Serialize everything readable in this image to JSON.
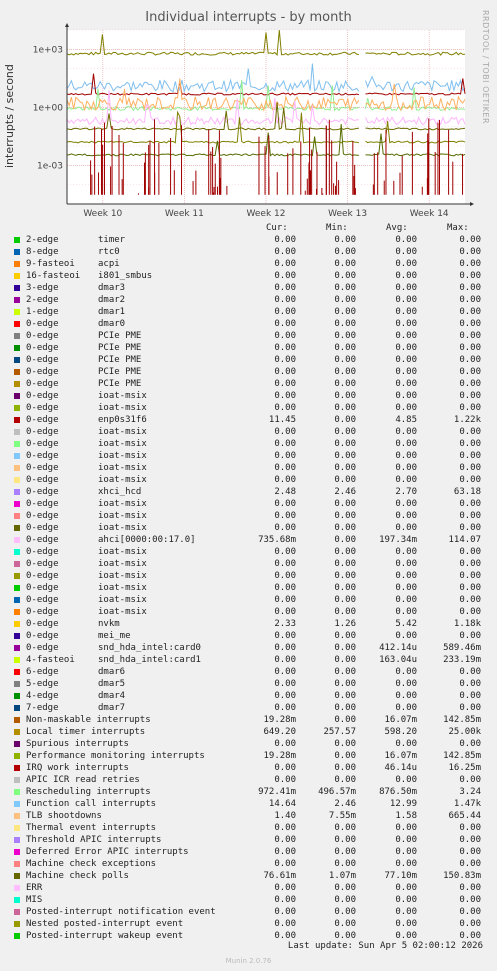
{
  "title": "Individual interrupts - by month",
  "vendor": "RRDTOOL / TOBI OETIKER",
  "ylabel": "interrupts / second",
  "chart_data": {
    "type": "line",
    "yscale": "log",
    "title": "Individual interrupts - by month",
    "ylabel": "interrupts / second",
    "ylim": [
      1e-05,
      10000
    ],
    "yticks": [
      {
        "v": 1000,
        "label": "1e+03"
      },
      {
        "v": 1,
        "label": "1e+00"
      },
      {
        "v": 0.001,
        "label": "1e-03"
      }
    ],
    "x_ticks": [
      "Week 10",
      "Week 11",
      "Week 12",
      "Week 13",
      "Week 14"
    ],
    "x_gap": [
      0.735,
      0.745
    ],
    "bands": [
      {
        "name": "Local timer interrupts",
        "color": "#808000",
        "base": 598,
        "noise": 0.15
      },
      {
        "name": "Function call interrupts",
        "color": "#7fbfef",
        "base": 13,
        "noise": 0.6
      },
      {
        "name": "enp0s31f6",
        "color": "#a00000",
        "base": 4.85,
        "noise": 0.1
      },
      {
        "name": "Rescheduling interrupts",
        "color": "#90ee90",
        "base": 0.87,
        "noise": 0.2
      },
      {
        "name": "TLB shootdowns",
        "color": "#ffb060",
        "base": 1.58,
        "noise": 0.7
      },
      {
        "name": "ahci[0000:00:17.0]",
        "color": "#ffb6ff",
        "base": 0.197,
        "noise": 0.4
      },
      {
        "name": "Machine check polls",
        "color": "#6b6b00",
        "base": 0.077,
        "noise": 0.1
      },
      {
        "name": "Non-maskable interrupts",
        "color": "#808000",
        "base": 0.016,
        "noise": 0.1
      },
      {
        "name": "Performance monitoring interrupts",
        "color": "#556b00",
        "base": 0.0035,
        "noise": 0.1
      }
    ],
    "spike_series": {
      "name": "enp0s31f6",
      "color": "#a00000",
      "base": 3e-05,
      "peak": 0.3,
      "count": 90
    }
  },
  "legend_header": {
    "cur": "Cur:",
    "min": "Min:",
    "avg": "Avg:",
    "max": "Max:"
  },
  "legend": [
    {
      "name": "2-edge",
      "dev": "timer",
      "color": "#00cc00",
      "cur": "0.00",
      "min": "0.00",
      "avg": "0.00",
      "max": "0.00"
    },
    {
      "name": "8-edge",
      "dev": "rtc0",
      "color": "#0066b3",
      "cur": "0.00",
      "min": "0.00",
      "avg": "0.00",
      "max": "0.00"
    },
    {
      "name": "9-fasteoi",
      "dev": "acpi",
      "color": "#ff8000",
      "cur": "0.00",
      "min": "0.00",
      "avg": "0.00",
      "max": "0.00"
    },
    {
      "name": "16-fasteoi",
      "dev": "i801_smbus",
      "color": "#ffcc00",
      "cur": "0.00",
      "min": "0.00",
      "avg": "0.00",
      "max": "0.00"
    },
    {
      "name": "3-edge",
      "dev": "dmar3",
      "color": "#330099",
      "cur": "0.00",
      "min": "0.00",
      "avg": "0.00",
      "max": "0.00"
    },
    {
      "name": "2-edge",
      "dev": "dmar2",
      "color": "#990099",
      "cur": "0.00",
      "min": "0.00",
      "avg": "0.00",
      "max": "0.00"
    },
    {
      "name": "1-edge",
      "dev": "dmar1",
      "color": "#ccff00",
      "cur": "0.00",
      "min": "0.00",
      "avg": "0.00",
      "max": "0.00"
    },
    {
      "name": "0-edge",
      "dev": "dmar0",
      "color": "#ff0000",
      "cur": "0.00",
      "min": "0.00",
      "avg": "0.00",
      "max": "0.00"
    },
    {
      "name": "0-edge",
      "dev": "PCIe PME",
      "color": "#808080",
      "cur": "0.00",
      "min": "0.00",
      "avg": "0.00",
      "max": "0.00"
    },
    {
      "name": "0-edge",
      "dev": "PCIe PME",
      "color": "#008f00",
      "cur": "0.00",
      "min": "0.00",
      "avg": "0.00",
      "max": "0.00"
    },
    {
      "name": "0-edge",
      "dev": "PCIe PME",
      "color": "#00487d",
      "cur": "0.00",
      "min": "0.00",
      "avg": "0.00",
      "max": "0.00"
    },
    {
      "name": "0-edge",
      "dev": "PCIe PME",
      "color": "#b35a00",
      "cur": "0.00",
      "min": "0.00",
      "avg": "0.00",
      "max": "0.00"
    },
    {
      "name": "0-edge",
      "dev": "PCIe PME",
      "color": "#b38f00",
      "cur": "0.00",
      "min": "0.00",
      "avg": "0.00",
      "max": "0.00"
    },
    {
      "name": "0-edge",
      "dev": "ioat-msix",
      "color": "#6b006b",
      "cur": "0.00",
      "min": "0.00",
      "avg": "0.00",
      "max": "0.00"
    },
    {
      "name": "0-edge",
      "dev": "ioat-msix",
      "color": "#8fb300",
      "cur": "0.00",
      "min": "0.00",
      "avg": "0.00",
      "max": "0.00"
    },
    {
      "name": "0-edge",
      "dev": "enp0s31f6",
      "color": "#b30000",
      "cur": "11.45",
      "min": "0.00",
      "avg": "4.85",
      "max": "1.22k"
    },
    {
      "name": "0-edge",
      "dev": "ioat-msix",
      "color": "#bebebe",
      "cur": "0.00",
      "min": "0.00",
      "avg": "0.00",
      "max": "0.00"
    },
    {
      "name": "0-edge",
      "dev": "ioat-msix",
      "color": "#80ff80",
      "cur": "0.00",
      "min": "0.00",
      "avg": "0.00",
      "max": "0.00"
    },
    {
      "name": "0-edge",
      "dev": "ioat-msix",
      "color": "#80c9ff",
      "cur": "0.00",
      "min": "0.00",
      "avg": "0.00",
      "max": "0.00"
    },
    {
      "name": "0-edge",
      "dev": "ioat-msix",
      "color": "#ffc080",
      "cur": "0.00",
      "min": "0.00",
      "avg": "0.00",
      "max": "0.00"
    },
    {
      "name": "0-edge",
      "dev": "ioat-msix",
      "color": "#ffe680",
      "cur": "0.00",
      "min": "0.00",
      "avg": "0.00",
      "max": "0.00"
    },
    {
      "name": "0-edge",
      "dev": "xhci_hcd",
      "color": "#aa80ff",
      "cur": "2.48",
      "min": "2.46",
      "avg": "2.70",
      "max": "63.18"
    },
    {
      "name": "0-edge",
      "dev": "ioat-msix",
      "color": "#ee00cc",
      "cur": "0.00",
      "min": "0.00",
      "avg": "0.00",
      "max": "0.00"
    },
    {
      "name": "0-edge",
      "dev": "ioat-msix",
      "color": "#ff8080",
      "cur": "0.00",
      "min": "0.00",
      "avg": "0.00",
      "max": "0.00"
    },
    {
      "name": "0-edge",
      "dev": "ioat-msix",
      "color": "#666600",
      "cur": "0.00",
      "min": "0.00",
      "avg": "0.00",
      "max": "0.00"
    },
    {
      "name": "0-edge",
      "dev": "ahci[0000:00:17.0]",
      "color": "#ffbfff",
      "cur": "735.68m",
      "min": "0.00",
      "avg": "197.34m",
      "max": "114.07"
    },
    {
      "name": "0-edge",
      "dev": "ioat-msix",
      "color": "#00ffcc",
      "cur": "0.00",
      "min": "0.00",
      "avg": "0.00",
      "max": "0.00"
    },
    {
      "name": "0-edge",
      "dev": "ioat-msix",
      "color": "#cc6699",
      "cur": "0.00",
      "min": "0.00",
      "avg": "0.00",
      "max": "0.00"
    },
    {
      "name": "0-edge",
      "dev": "ioat-msix",
      "color": "#999900",
      "cur": "0.00",
      "min": "0.00",
      "avg": "0.00",
      "max": "0.00"
    },
    {
      "name": "0-edge",
      "dev": "ioat-msix",
      "color": "#00cc00",
      "cur": "0.00",
      "min": "0.00",
      "avg": "0.00",
      "max": "0.00"
    },
    {
      "name": "0-edge",
      "dev": "ioat-msix",
      "color": "#0066b3",
      "cur": "0.00",
      "min": "0.00",
      "avg": "0.00",
      "max": "0.00"
    },
    {
      "name": "0-edge",
      "dev": "ioat-msix",
      "color": "#ff8000",
      "cur": "0.00",
      "min": "0.00",
      "avg": "0.00",
      "max": "0.00"
    },
    {
      "name": "0-edge",
      "dev": "nvkm",
      "color": "#ffcc00",
      "cur": "2.33",
      "min": "1.26",
      "avg": "5.42",
      "max": "1.18k"
    },
    {
      "name": "0-edge",
      "dev": "mei_me",
      "color": "#330099",
      "cur": "0.00",
      "min": "0.00",
      "avg": "0.00",
      "max": "0.00"
    },
    {
      "name": "0-edge",
      "dev": "snd_hda_intel:card0",
      "color": "#990099",
      "cur": "0.00",
      "min": "0.00",
      "avg": "412.14u",
      "max": "589.46m"
    },
    {
      "name": "4-fasteoi",
      "dev": "snd_hda_intel:card1",
      "color": "#ccff00",
      "cur": "0.00",
      "min": "0.00",
      "avg": "163.04u",
      "max": "233.19m"
    },
    {
      "name": "6-edge",
      "dev": "dmar6",
      "color": "#ff0000",
      "cur": "0.00",
      "min": "0.00",
      "avg": "0.00",
      "max": "0.00"
    },
    {
      "name": "5-edge",
      "dev": "dmar5",
      "color": "#808080",
      "cur": "0.00",
      "min": "0.00",
      "avg": "0.00",
      "max": "0.00"
    },
    {
      "name": "4-edge",
      "dev": "dmar4",
      "color": "#008f00",
      "cur": "0.00",
      "min": "0.00",
      "avg": "0.00",
      "max": "0.00"
    },
    {
      "name": "7-edge",
      "dev": "dmar7",
      "color": "#00487d",
      "cur": "0.00",
      "min": "0.00",
      "avg": "0.00",
      "max": "0.00"
    },
    {
      "name": "Non-maskable interrupts",
      "dev": "",
      "color": "#b35a00",
      "cur": "19.28m",
      "min": "0.00",
      "avg": "16.07m",
      "max": "142.85m"
    },
    {
      "name": "Local timer interrupts",
      "dev": "",
      "color": "#b38f00",
      "cur": "649.20",
      "min": "257.57",
      "avg": "598.20",
      "max": "25.00k"
    },
    {
      "name": "Spurious interrupts",
      "dev": "",
      "color": "#6b006b",
      "cur": "0.00",
      "min": "0.00",
      "avg": "0.00",
      "max": "0.00"
    },
    {
      "name": "Performance monitoring interrupts",
      "dev": "",
      "color": "#8fb300",
      "cur": "19.28m",
      "min": "0.00",
      "avg": "16.07m",
      "max": "142.85m"
    },
    {
      "name": "IRQ work interrupts",
      "dev": "",
      "color": "#b30000",
      "cur": "0.00",
      "min": "0.00",
      "avg": "46.14u",
      "max": "16.25m"
    },
    {
      "name": "APIC ICR read retries",
      "dev": "",
      "color": "#bebebe",
      "cur": "0.00",
      "min": "0.00",
      "avg": "0.00",
      "max": "0.00"
    },
    {
      "name": "Rescheduling interrupts",
      "dev": "",
      "color": "#80ff80",
      "cur": "972.41m",
      "min": "496.57m",
      "avg": "876.50m",
      "max": "3.24"
    },
    {
      "name": "Function call interrupts",
      "dev": "",
      "color": "#80c9ff",
      "cur": "14.64",
      "min": "2.46",
      "avg": "12.99",
      "max": "1.47k"
    },
    {
      "name": "TLB shootdowns",
      "dev": "",
      "color": "#ffc080",
      "cur": "1.40",
      "min": "7.55m",
      "avg": "1.58",
      "max": "665.44"
    },
    {
      "name": "Thermal event interrupts",
      "dev": "",
      "color": "#ffe680",
      "cur": "0.00",
      "min": "0.00",
      "avg": "0.00",
      "max": "0.00"
    },
    {
      "name": "Threshold APIC interrupts",
      "dev": "",
      "color": "#aa80ff",
      "cur": "0.00",
      "min": "0.00",
      "avg": "0.00",
      "max": "0.00"
    },
    {
      "name": "Deferred Error APIC interrupts",
      "dev": "",
      "color": "#ee00cc",
      "cur": "0.00",
      "min": "0.00",
      "avg": "0.00",
      "max": "0.00"
    },
    {
      "name": "Machine check exceptions",
      "dev": "",
      "color": "#ff8080",
      "cur": "0.00",
      "min": "0.00",
      "avg": "0.00",
      "max": "0.00"
    },
    {
      "name": "Machine check polls",
      "dev": "",
      "color": "#666600",
      "cur": "76.61m",
      "min": "1.07m",
      "avg": "77.10m",
      "max": "150.83m"
    },
    {
      "name": "ERR",
      "dev": "",
      "color": "#ffbfff",
      "cur": "0.00",
      "min": "0.00",
      "avg": "0.00",
      "max": "0.00"
    },
    {
      "name": "MIS",
      "dev": "",
      "color": "#00ffcc",
      "cur": "0.00",
      "min": "0.00",
      "avg": "0.00",
      "max": "0.00"
    },
    {
      "name": "Posted-interrupt notification event",
      "dev": "",
      "color": "#cc6699",
      "cur": "0.00",
      "min": "0.00",
      "avg": "0.00",
      "max": "0.00"
    },
    {
      "name": "Nested posted-interrupt event",
      "dev": "",
      "color": "#999900",
      "cur": "0.00",
      "min": "0.00",
      "avg": "0.00",
      "max": "0.00"
    },
    {
      "name": "Posted-interrupt wakeup event",
      "dev": "",
      "color": "#00cc00",
      "cur": "0.00",
      "min": "0.00",
      "avg": "0.00",
      "max": "0.00"
    }
  ],
  "last_update": "Last update: Sun Apr  5 02:00:12 2026",
  "footer": "Munin 2.0.76"
}
